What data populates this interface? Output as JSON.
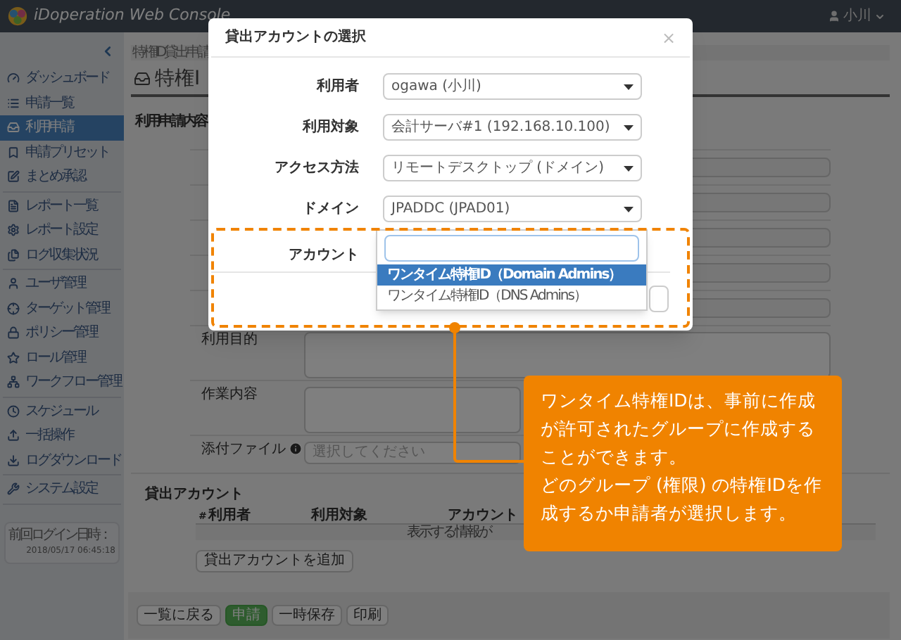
{
  "header": {
    "app_title": "iDoperation Web Console",
    "user": "小川"
  },
  "sidebar": {
    "groups": [
      {
        "items": [
          {
            "label": "ダッシュボード",
            "selected": false
          },
          {
            "label": "申請一覧",
            "selected": false
          },
          {
            "label": "利用申請",
            "selected": true
          },
          {
            "label": "申請プリセット",
            "selected": false
          },
          {
            "label": "まとめ承認",
            "selected": false
          }
        ]
      },
      {
        "items": [
          {
            "label": "レポート一覧",
            "selected": false
          },
          {
            "label": "レポート設定",
            "selected": false
          },
          {
            "label": "ログ収集状況",
            "selected": false
          }
        ]
      },
      {
        "items": [
          {
            "label": "ユーザ管理",
            "selected": false
          },
          {
            "label": "ターゲット管理",
            "selected": false
          },
          {
            "label": "ポリシー管理",
            "selected": false
          },
          {
            "label": "ロール管理",
            "selected": false
          },
          {
            "label": "ワークフロー管理",
            "selected": false
          }
        ]
      },
      {
        "items": [
          {
            "label": "スケジュール",
            "selected": false
          },
          {
            "label": "一括操作",
            "selected": false
          },
          {
            "label": "ログダウンロード",
            "selected": false
          }
        ]
      },
      {
        "items": [
          {
            "label": "システム設定",
            "selected": false
          }
        ]
      }
    ],
    "last_login": {
      "label": "前回ログイン日時：",
      "value": "2018/05/17 06:45:18"
    }
  },
  "main": {
    "breadcrumb": "特権ID貸出申請",
    "page_title": "特権I",
    "section_title": "利用申請内容",
    "form_rows": [
      {
        "kind": "input"
      },
      {
        "kind": "input"
      },
      {
        "kind": "input"
      },
      {
        "kind": "input"
      },
      {
        "kind": "input"
      },
      {
        "label": "利用目的",
        "kind": "textarea"
      },
      {
        "label": "作業内容",
        "kind": "textarea"
      },
      {
        "label": "添付ファイル",
        "kind": "file",
        "placeholder": "選択してください"
      }
    ],
    "accounts": {
      "title": "貸出アカウント",
      "columns": [
        "#",
        "利用者",
        "利用対象",
        "アカウント"
      ],
      "empty_text": "表示する情報が",
      "add_button": "貸出アカウントを追加"
    },
    "footer_buttons": [
      {
        "label": "一覧に戻る",
        "kind": "default"
      },
      {
        "label": "申請",
        "kind": "primary"
      },
      {
        "label": "一時保存",
        "kind": "default"
      },
      {
        "label": "印刷",
        "kind": "default"
      }
    ]
  },
  "modal": {
    "title": "貸出アカウントの選択",
    "close": "×",
    "fields": [
      {
        "label": "利用者",
        "value": "ogawa (小川)"
      },
      {
        "label": "利用対象",
        "value": "会計サーバ#1 (192.168.10.100)"
      },
      {
        "label": "アクセス方法",
        "value": "リモートデスクトップ (ドメイン)"
      },
      {
        "label": "ドメイン",
        "value": "JPADDC (JPAD01)"
      }
    ],
    "account": {
      "label": "アカウント",
      "options": [
        {
          "label": "ワンタイム特権ID（Domain Admins）",
          "selected": true
        },
        {
          "label": "ワンタイム特権ID（DNS Admins）",
          "selected": false
        }
      ]
    }
  },
  "callout": {
    "paragraphs": [
      "ワンタイム特権IDは、事前に作成が許可されたグループに作成することができます。",
      "どのグループ (権限) の特権IDを作成するか申請者が選択します。"
    ]
  }
}
